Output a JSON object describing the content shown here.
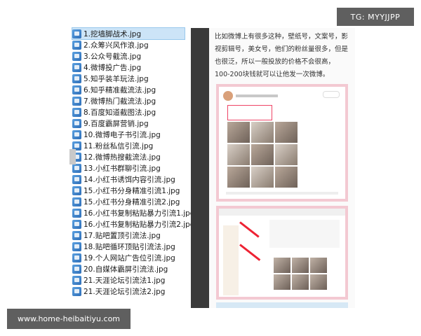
{
  "files": [
    "1.挖墙脚战术.jpg",
    "2.众筹兴风作浪.jpg",
    "3.公众号截流.jpg",
    "4.微博投广告.jpg",
    "5.知乎装羊玩法.jpg",
    "6.知乎精准截流法.jpg",
    "7.微博热门截流法.jpg",
    "8.百度知道截图法.jpg",
    "9.百度霸屏营销.jpg",
    "10.微博电子书引流.jpg",
    "11.粉丝私信引流.jpg",
    "12.微博热搜截流法.jpg",
    "13.小红书群聊引流.jpg",
    "14.小红书诱饵内容引流.jpg",
    "15.小红书分身精准引流1.jpg",
    "15.小红书分身精准引流2.jpg",
    "16.小红书复制粘贴暴力引流1.jpg",
    "16.小红书复制粘贴暴力引流2.jpg",
    "17.贴吧置顶引流法.jpg",
    "18.贴吧循环顶贴引流法.jpg",
    "19.个人网站广告位引流.jpg",
    "20.自媒体霸屏引流法.jpg",
    "21.天涯论坛引流法1.jpg",
    "21.天涯论坛引流法2.jpg"
  ],
  "selected_index": 0,
  "article": {
    "paragraph": "比如微博上有很多这种，壁纸号，文案号，影视剪辑号，美女号，他们的粉丝量很多，但是也很泛，所以一般投放的价格不会很高，100-200块钱就可以让他发一次微博。"
  },
  "watermark": {
    "tg": "TG: MYYJJPP",
    "url": "www.home-heibaitiyu.com"
  }
}
